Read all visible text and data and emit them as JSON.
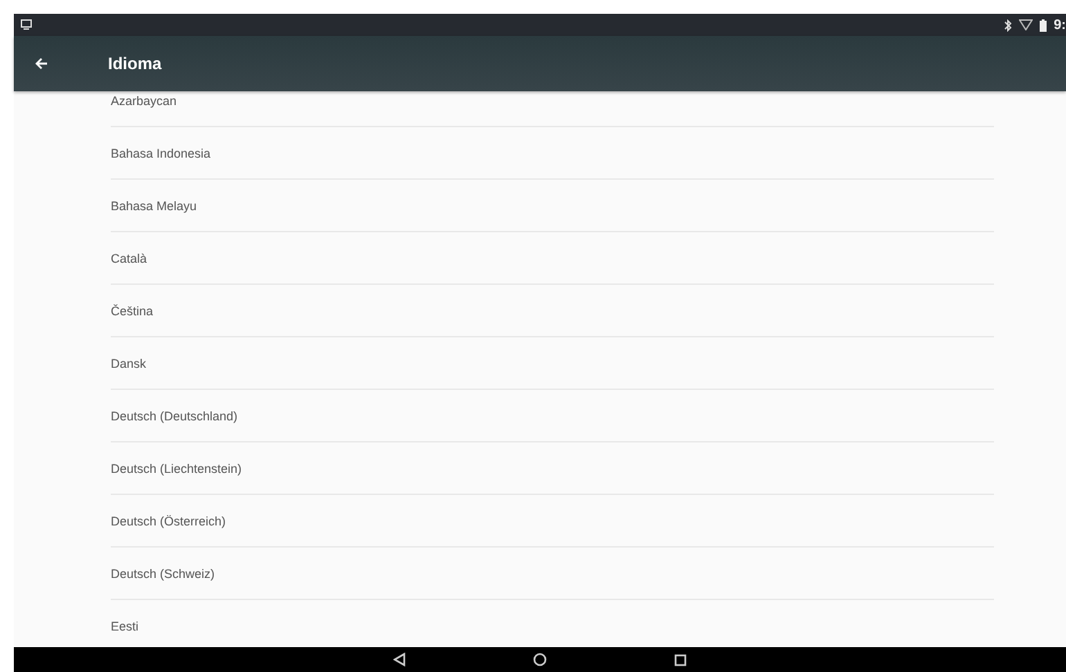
{
  "status_bar": {
    "time": "9:"
  },
  "toolbar": {
    "title": "Idioma"
  },
  "languages": [
    {
      "label": "Azarbaycan"
    },
    {
      "label": "Bahasa Indonesia"
    },
    {
      "label": "Bahasa Melayu"
    },
    {
      "label": "Català"
    },
    {
      "label": "Čeština"
    },
    {
      "label": "Dansk"
    },
    {
      "label": "Deutsch (Deutschland)"
    },
    {
      "label": "Deutsch (Liechtenstein)"
    },
    {
      "label": "Deutsch (Österreich)"
    },
    {
      "label": "Deutsch (Schweiz)"
    },
    {
      "label": "Eesti"
    }
  ]
}
